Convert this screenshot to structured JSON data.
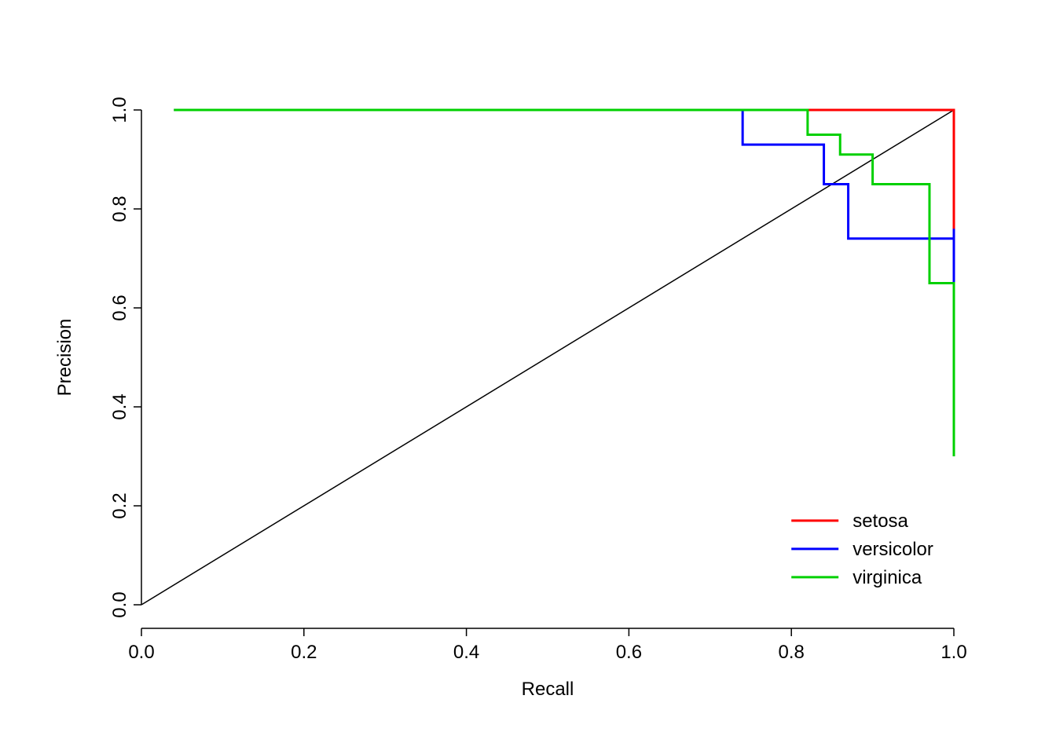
{
  "chart_data": {
    "type": "line",
    "title": "",
    "xlabel": "Recall",
    "ylabel": "Precision",
    "xlim": [
      0.0,
      1.0
    ],
    "ylim": [
      0.0,
      1.0
    ],
    "xticks": [
      0.0,
      0.2,
      0.4,
      0.6,
      0.8,
      1.0
    ],
    "yticks": [
      0.0,
      0.2,
      0.4,
      0.6,
      0.8,
      1.0
    ],
    "legend_position": "bottom-right",
    "diagonal": {
      "from": [
        0.0,
        0.0
      ],
      "to": [
        1.0,
        1.0
      ],
      "color": "#000000"
    },
    "series": [
      {
        "name": "setosa",
        "color": "#ff0000",
        "points": [
          [
            0.04,
            1.0
          ],
          [
            1.0,
            1.0
          ],
          [
            1.0,
            0.3
          ]
        ]
      },
      {
        "name": "versicolor",
        "color": "#0000ff",
        "points": [
          [
            0.04,
            1.0
          ],
          [
            0.74,
            1.0
          ],
          [
            0.74,
            0.93
          ],
          [
            0.84,
            0.93
          ],
          [
            0.84,
            0.85
          ],
          [
            0.87,
            0.85
          ],
          [
            0.87,
            0.74
          ],
          [
            1.0,
            0.74
          ],
          [
            1.0,
            0.76
          ],
          [
            1.0,
            0.38
          ]
        ]
      },
      {
        "name": "virginica",
        "color": "#00d000",
        "points": [
          [
            0.04,
            1.0
          ],
          [
            0.82,
            1.0
          ],
          [
            0.82,
            0.95
          ],
          [
            0.86,
            0.95
          ],
          [
            0.86,
            0.91
          ],
          [
            0.9,
            0.91
          ],
          [
            0.9,
            0.85
          ],
          [
            0.97,
            0.85
          ],
          [
            0.97,
            0.65
          ],
          [
            1.0,
            0.65
          ],
          [
            1.0,
            0.3
          ]
        ]
      }
    ]
  },
  "legend": {
    "items": [
      {
        "label": "setosa",
        "color": "#ff0000"
      },
      {
        "label": "versicolor",
        "color": "#0000ff"
      },
      {
        "label": "virginica",
        "color": "#00d000"
      }
    ]
  },
  "axis": {
    "x_label": "Recall",
    "y_label": "Precision",
    "x_ticks": [
      "0.0",
      "0.2",
      "0.4",
      "0.6",
      "0.8",
      "1.0"
    ],
    "y_ticks": [
      "0.0",
      "0.2",
      "0.4",
      "0.6",
      "0.8",
      "1.0"
    ]
  }
}
